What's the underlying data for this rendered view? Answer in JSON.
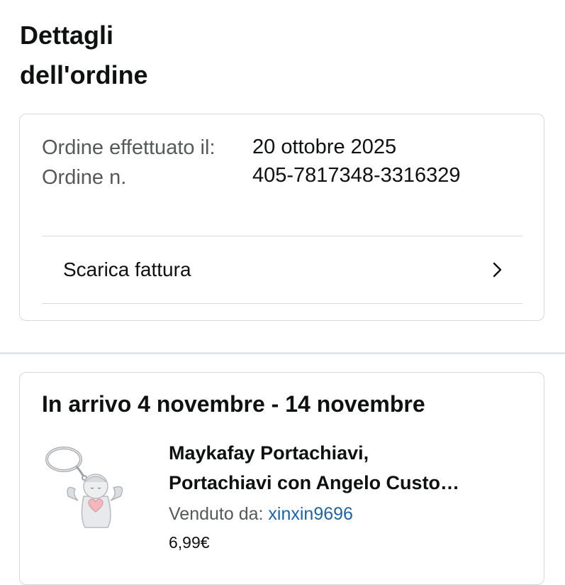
{
  "page": {
    "title_line1": "Dettagli",
    "title_line2": "dell'ordine"
  },
  "order": {
    "placed_label": "Ordine effettuato il:",
    "number_label": "Ordine n.",
    "placed_value": "20 ottobre 2025",
    "number_value": "405-7817348-3316329",
    "invoice_label": "Scarica fattura",
    "invoice_icon": "chevron-right-icon"
  },
  "shipment": {
    "heading": "In arrivo 4 novembre - 14 novembre",
    "product": {
      "title_line1": "Maykafay Portachiavi,",
      "title_line2": "Portachiavi con Angelo Custo…",
      "seller_label": "Venduto da:",
      "seller_name": "xinxin9696",
      "price": "6,99€",
      "image_icon": "angel-keychain-image"
    }
  },
  "colors": {
    "text": "#0f1111",
    "secondary_text": "#565959",
    "link": "#2162a1",
    "border": "#d5d9d9"
  }
}
